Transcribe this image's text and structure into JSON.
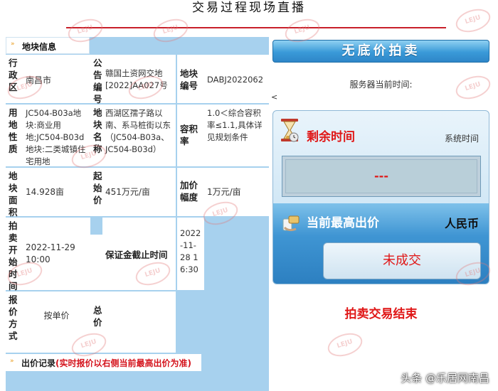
{
  "page": {
    "title": "交易过程现场直播"
  },
  "watermark": {
    "text": "LEJU"
  },
  "block_info": {
    "header": "地块信息",
    "district_label": "行政区",
    "district_value": "南昌市",
    "notice_label": "公告编号",
    "notice_value": "赣国土资网交地[2022]AA027号",
    "parcel_no_label": "地块编号",
    "parcel_no_value": "DABJ2022062",
    "land_use_label": "用地性质",
    "land_use_value": "JC504-B03a地块:商业用地;JC504-B03d地块:二类城镇住宅用地",
    "parcel_name_label": "地块名称",
    "parcel_name_value": "西湖区孺子路以南、系马桩街以东（JC504-B03a、JC504-B03d）",
    "far_label": "容积率",
    "far_value": "1.0＜综合容积率≤1.1,具体详见规划条件",
    "area_label": "地块面积",
    "area_value": "14.928亩",
    "start_price_label": "起始价",
    "start_price_value": "451万元/亩",
    "increment_label": "加价幅度",
    "increment_value": "1万元/亩",
    "auction_start_label": "拍卖开始时间",
    "auction_start_value": "2022-11-29 10:00",
    "deposit_deadline_label": "保证金截止时间",
    "deposit_deadline_value": "2022-11-28 16:30",
    "quote_method_label": "报价方式",
    "quote_method_value": "按单价",
    "total_price_label": "总价"
  },
  "bid_record": {
    "label": "出价记录",
    "note": "(实时报价以右侧当前最高出价为准)"
  },
  "auction": {
    "banner": "无底价拍卖",
    "server_time_label": "服务器当前时间:",
    "lt_mark": "<",
    "remaining_label": "剩余时间",
    "system_time_label": "系统时间",
    "countdown": "---",
    "highest_bid_label": "当前最高出价",
    "currency": "人民币",
    "deal_status": "未成交",
    "ended": "拍卖交易结束"
  },
  "credit": {
    "text": "头条 @乐居网南昌"
  },
  "colors": {
    "accent_red": "#e01818",
    "panel_blue": "#a7d1ee",
    "title_rule": "#c8202a"
  }
}
